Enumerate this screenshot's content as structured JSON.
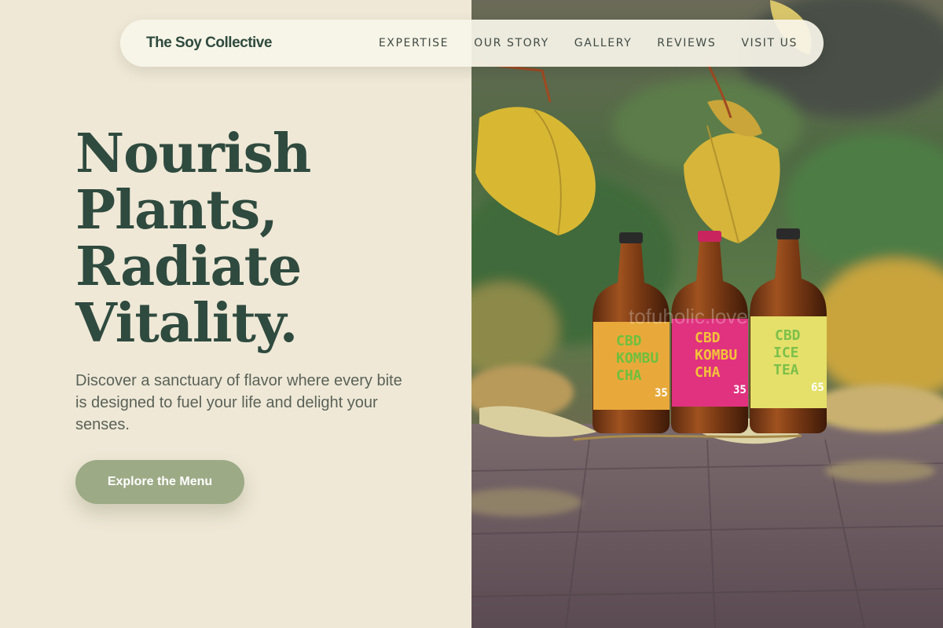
{
  "nav": {
    "brand": "The Soy Collective",
    "links": [
      "EXPERTISE",
      "OUR STORY",
      "GALLERY",
      "REVIEWS",
      "VISIT US"
    ]
  },
  "hero": {
    "title_lines": [
      "Nourish",
      "Plants,",
      "Radiate",
      "Vitality."
    ],
    "subtitle": "Discover a sanctuary of flavor where every bite is designed to fuel your life and delight your senses.",
    "cta_label": "Explore the Menu"
  },
  "photo": {
    "watermark": "tofuholic.love",
    "bottles": [
      {
        "line1": "CBD",
        "line2": "KOMBU",
        "line3": "CHA",
        "number": "35",
        "label_color": "#e8a93a",
        "text_color": "#6fbf3e"
      },
      {
        "line1": "CBD",
        "line2": "KOMBU",
        "line3": "CHA",
        "number": "35",
        "label_color": "#e0327f",
        "text_color": "#f4c23a"
      },
      {
        "line1": "CBD",
        "line2": "ICE",
        "line3": "TEA",
        "number": "65",
        "label_color": "#e4e06a",
        "text_color": "#7cc04a"
      }
    ]
  },
  "colors": {
    "background": "#efe8d6",
    "brand_green": "#2f4a3f",
    "cta": "#9caa86"
  }
}
